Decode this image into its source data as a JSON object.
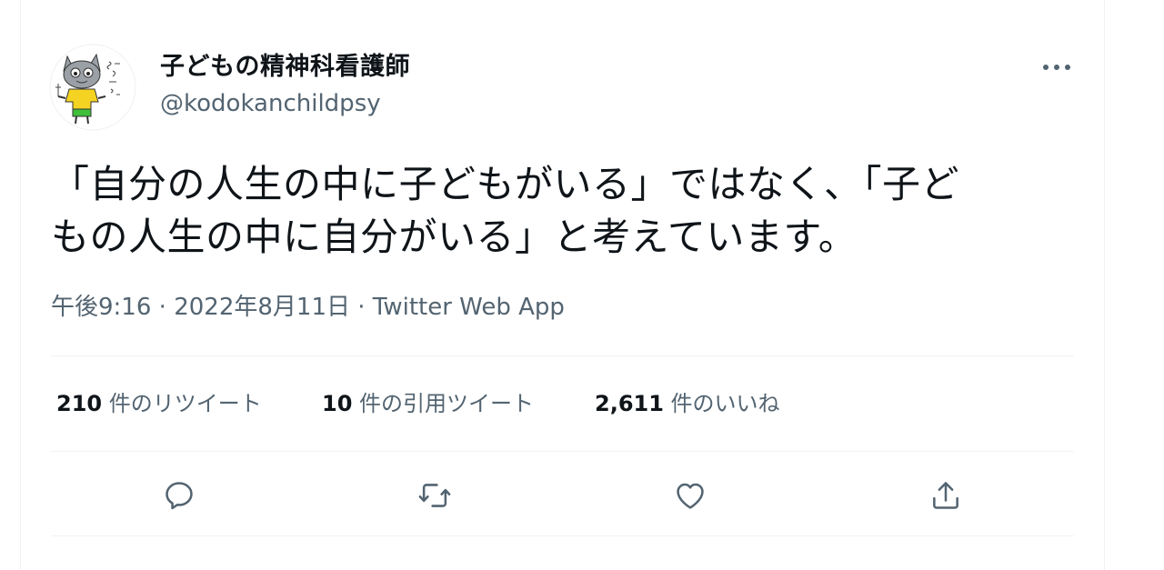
{
  "tweet": {
    "display_name": "子どもの精神科看護師",
    "handle": "@kodokanchildpsy",
    "text_line1": "「自分の人生の中に子どもがいる」ではなく、「子ど",
    "text_line2": "もの人生の中に自分がいる」と考えています。",
    "time": "午後9:16",
    "date": "2022年8月11日",
    "source": "Twitter Web App",
    "separator": " · "
  },
  "stats": {
    "retweets_count": "210",
    "retweets_label": " 件のリツイート",
    "quotes_count": "10",
    "quotes_label": " 件の引用ツイート",
    "likes_count": "2,611",
    "likes_label": " 件のいいね"
  },
  "icons": {
    "more": "more-icon",
    "reply": "reply-icon",
    "retweet": "retweet-icon",
    "like": "like-icon",
    "share": "share-icon"
  },
  "colors": {
    "text": "#0f1419",
    "secondary": "#536471",
    "divider": "#eff3f4",
    "avatar_shirt": "#f5d322",
    "avatar_shorts": "#3fbf3a"
  }
}
